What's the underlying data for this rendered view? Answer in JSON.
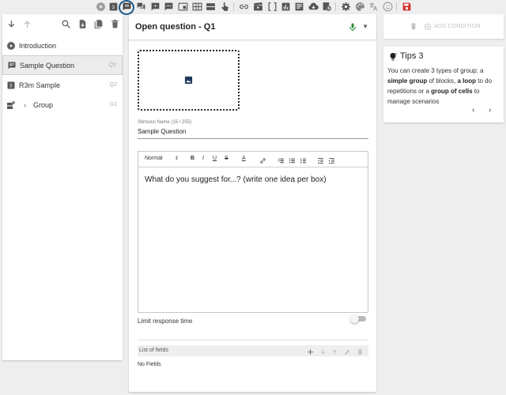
{
  "toolbar": {
    "icons": [
      "introduction-icon",
      "r3m-icon",
      "open-question-icon",
      "chat-icon",
      "message-icon",
      "dialog-icon",
      "media-icon",
      "grid-icon",
      "split-icon",
      "pointer-icon",
      "link-icon",
      "clapper-icon",
      "brackets-icon",
      "chart-icon",
      "document-icon",
      "cloud-download-icon",
      "quota-icon",
      "settings-icon",
      "palette-icon",
      "translate-icon",
      "emoji-icon",
      "save-icon"
    ],
    "selected": "open-question-icon"
  },
  "left_panel": {
    "blocks": [
      {
        "label": "Introduction",
        "code": "",
        "icon": "play-circle-icon"
      },
      {
        "label": "Sample Question",
        "code": "Q1",
        "icon": "message-icon"
      },
      {
        "label": "R3m Sample",
        "code": "Q2",
        "icon": "r3m-icon"
      },
      {
        "label": "Group",
        "code": "G1",
        "icon": "group-icon"
      }
    ]
  },
  "question": {
    "title": "Open question - Q1",
    "stimulus_label": "Stimulus Name (15 / 255)",
    "stimulus_value": "Sample Question",
    "editor": {
      "format_select": "Normal",
      "text": "What do you suggest for...? (write one idea per box)"
    },
    "limit_label": "Limit response time",
    "limit_enabled": false,
    "fields_title": "List of fields",
    "no_fields": "No Fields"
  },
  "right_panel": {
    "add_condition": "ADD CONDITION",
    "tips": {
      "title": "Tips 3",
      "t1": "You can create 3 types of group: a ",
      "b1": "simple group",
      "t2": " of blocks, ",
      "b2": "a loop",
      "t3": " to do repetitions or a ",
      "b3": "group of cells",
      "t4": " to manage scenarios"
    }
  },
  "colors": {
    "save": "#d32f2f",
    "selected_ring": "#1a5a8a",
    "mic": "#2e8b3a"
  }
}
